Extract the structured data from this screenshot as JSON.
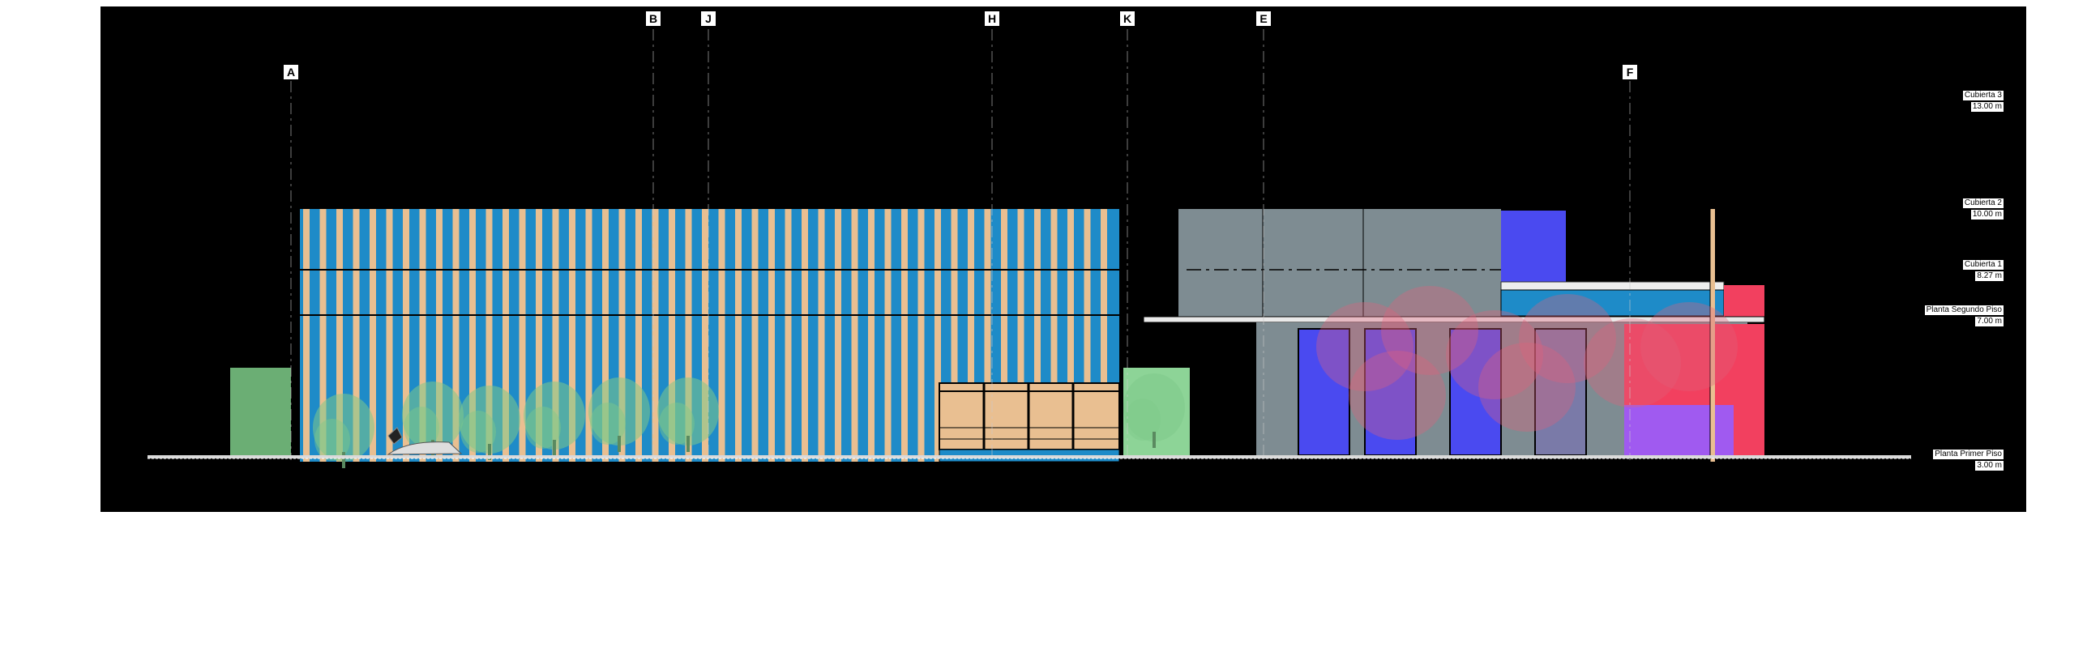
{
  "gridlines": [
    "A",
    "B",
    "J",
    "H",
    "K",
    "E",
    "F"
  ],
  "levels": [
    {
      "name": "Cubierta 3",
      "value": "13.00 m"
    },
    {
      "name": "Cubierta 2",
      "value": "10.00 m"
    },
    {
      "name": "Cubierta 1",
      "value": "8.27 m"
    },
    {
      "name": "Planta Segundo Piso",
      "value": "7.00 m"
    },
    {
      "name": "Planta Primer Piso",
      "value": "3.00 m"
    }
  ],
  "colors": {
    "background": "#000000",
    "facade_blue": "#1e8bc8",
    "facade_wood": "#e9bf91",
    "concrete_gray": "#7e8c92",
    "accent_blue": "#4a4af0",
    "accent_red": "#f2405f",
    "accent_purple": "#a05af0",
    "tree_green": "#7fc98a"
  }
}
